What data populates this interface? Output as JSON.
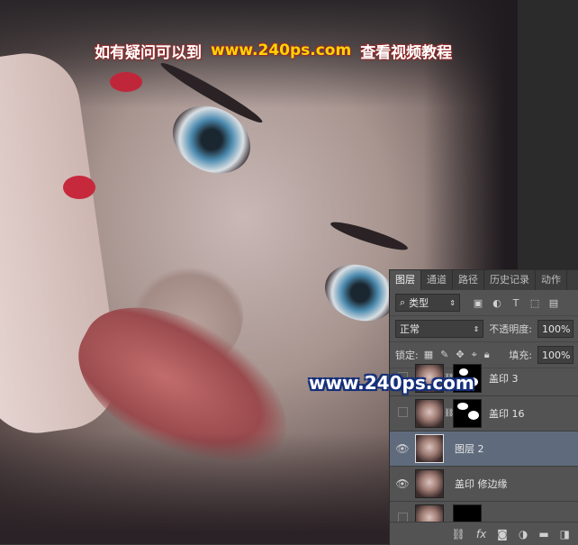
{
  "watermark": {
    "top_left_text": "如有疑问可以到",
    "top_url": "www.240ps.com",
    "top_right_text": "查看视频教程",
    "mid_url": "www.240ps.com"
  },
  "panel": {
    "tabs": [
      {
        "label": "图层",
        "active": true
      },
      {
        "label": "通道"
      },
      {
        "label": "路径"
      },
      {
        "label": "历史记录"
      },
      {
        "label": "动作"
      }
    ],
    "filter": {
      "kind_label": "类型",
      "icons": [
        "image-icon",
        "adjustment-circle-icon",
        "type-T-icon",
        "shape-icon",
        "smart-object-icon"
      ]
    },
    "blend_mode": "正常",
    "opacity_label": "不透明度:",
    "opacity_value": "100%",
    "lock_label": "锁定:",
    "fill_label": "填充:",
    "fill_value": "100%",
    "layers": [
      {
        "name": "盖印 3",
        "visible": false,
        "has_mask": true
      },
      {
        "name": "盖印 16",
        "visible": false,
        "has_mask": true
      },
      {
        "name": "图层 2",
        "visible": true,
        "selected": true,
        "has_mask": false
      },
      {
        "name": "盖印 修边缘",
        "visible": true,
        "has_mask": false
      },
      {
        "name": "",
        "visible": false,
        "has_mask": true
      }
    ],
    "bottom_icons": [
      "link-icon",
      "fx-icon",
      "add-mask-icon",
      "adjustment-icon",
      "folder-icon",
      "new-layer-icon"
    ],
    "fx_label": "fx"
  },
  "colors": {
    "panel_bg": "#535353",
    "selected_layer": "#5f6b7d",
    "watermark_url": "#ffd400",
    "nail_red": "#c0263a"
  }
}
